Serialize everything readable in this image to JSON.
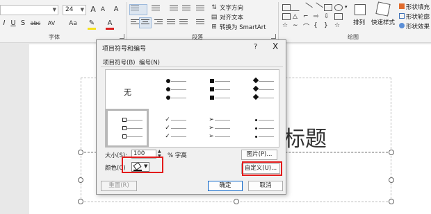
{
  "ribbon": {
    "font_size_value": "24",
    "font_group_label": "字体",
    "paragraph_group_label": "段落",
    "drawing_group_label": "绘图",
    "text_direction_label": "文字方向",
    "align_text_label": "对齐文本",
    "smartart_label": "转换为 SmartArt",
    "arrange_label": "排列",
    "quick_styles_label": "快速样式",
    "shape_fill_label": "形状填充",
    "shape_outline_label": "形状轮廓",
    "shape_effects_label": "形状效果",
    "format_buttons": [
      "I",
      "U",
      "S",
      "abc",
      "AV",
      "Aa",
      "A"
    ]
  },
  "slide": {
    "title_text": "标题"
  },
  "dialog": {
    "title": "项目符号和编号",
    "help": "?",
    "close": "X",
    "tabs": [
      "项目符号(B)",
      "编号(N)"
    ],
    "none_label": "无",
    "size_label": "大小(S):",
    "size_value": "100",
    "percent_label": "% 字高",
    "color_label": "颜色(C)",
    "picture_button": "图片(P)...",
    "customize_button": "自定义(U)...",
    "reset_button": "重置(R)",
    "ok_button": "确定",
    "cancel_button": "取消",
    "check_glyph": "✓",
    "arrow_glyph": "➢",
    "highlight_color": "#e31b1b"
  }
}
